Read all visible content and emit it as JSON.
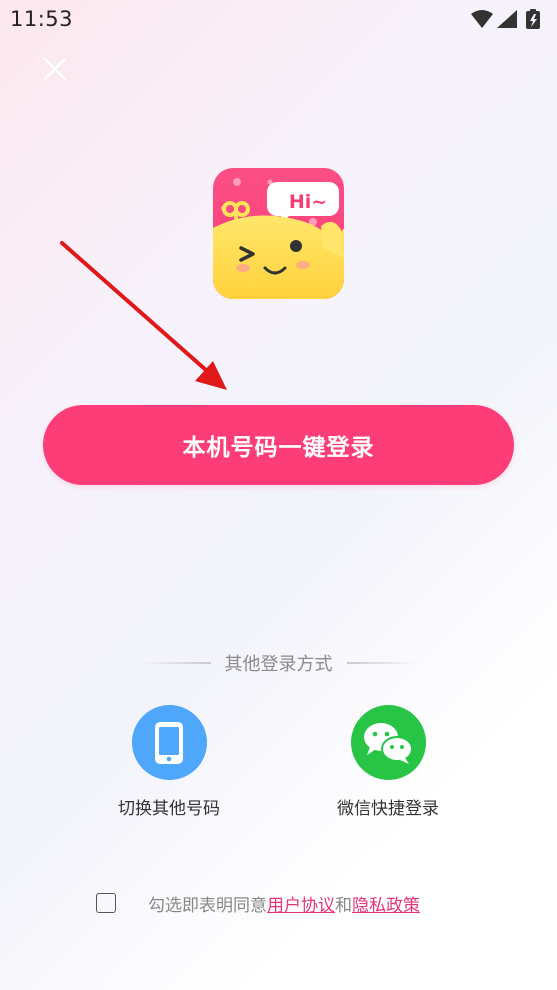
{
  "status_bar": {
    "time": "11:53",
    "icons": [
      "wifi-icon",
      "signal-icon",
      "battery-charging-icon"
    ]
  },
  "header": {
    "close_icon": "close-icon"
  },
  "logo": {
    "text": "Hi~"
  },
  "primary_action": {
    "label": "本机号码一键登录",
    "color": "#fc3d78"
  },
  "other_login": {
    "title": "其他登录方式",
    "options": [
      {
        "label": "切换其他号码",
        "icon": "phone-icon",
        "color": "#4ea7fb"
      },
      {
        "label": "微信快捷登录",
        "icon": "wechat-icon",
        "color": "#28c445"
      }
    ]
  },
  "agreement": {
    "prefix": "勾选即表明同意",
    "user_agreement": " 用户协议",
    "conjunction": " 和 ",
    "privacy_policy": "隐私政策",
    "link_color": "#e6357a"
  }
}
